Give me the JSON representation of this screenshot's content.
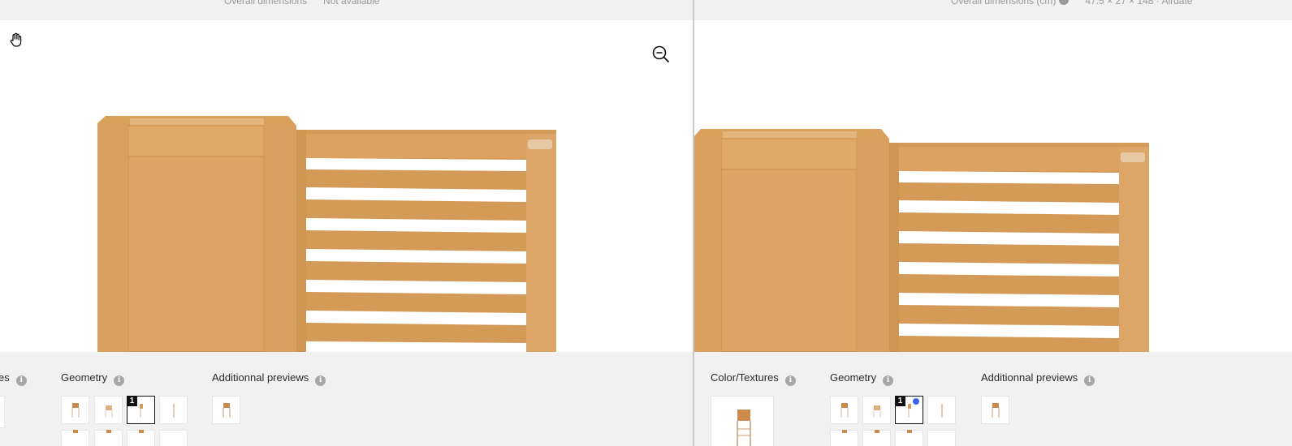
{
  "left_pane": {
    "top_bar": {
      "dims_label": "Overall dimensions",
      "dims_value": "Not available"
    },
    "panel": {
      "color_section_partial": "es",
      "geometry_title": "Geometry",
      "additional_title": "Additionnal previews",
      "selected_badge": "1"
    }
  },
  "right_pane": {
    "top_bar": {
      "dims_label": "Overall dimensions (cm)",
      "dims_value": "47.5 ×  27 ×  148 · Airdate"
    },
    "panel": {
      "color_title": "Color/Textures",
      "geometry_title": "Geometry",
      "additional_title": "Additionnal previews",
      "selected_badge": "1"
    }
  },
  "icons": {
    "hand": "hand-pan-icon",
    "zoom_out": "zoom-out-icon",
    "info": "info-icon"
  },
  "colors": {
    "wood_light": "#e3b174",
    "wood_mid": "#d9a25f",
    "wood_dark": "#c88a45",
    "accent_blue": "#3b63e8",
    "panel_bg": "#f1f1f1"
  }
}
